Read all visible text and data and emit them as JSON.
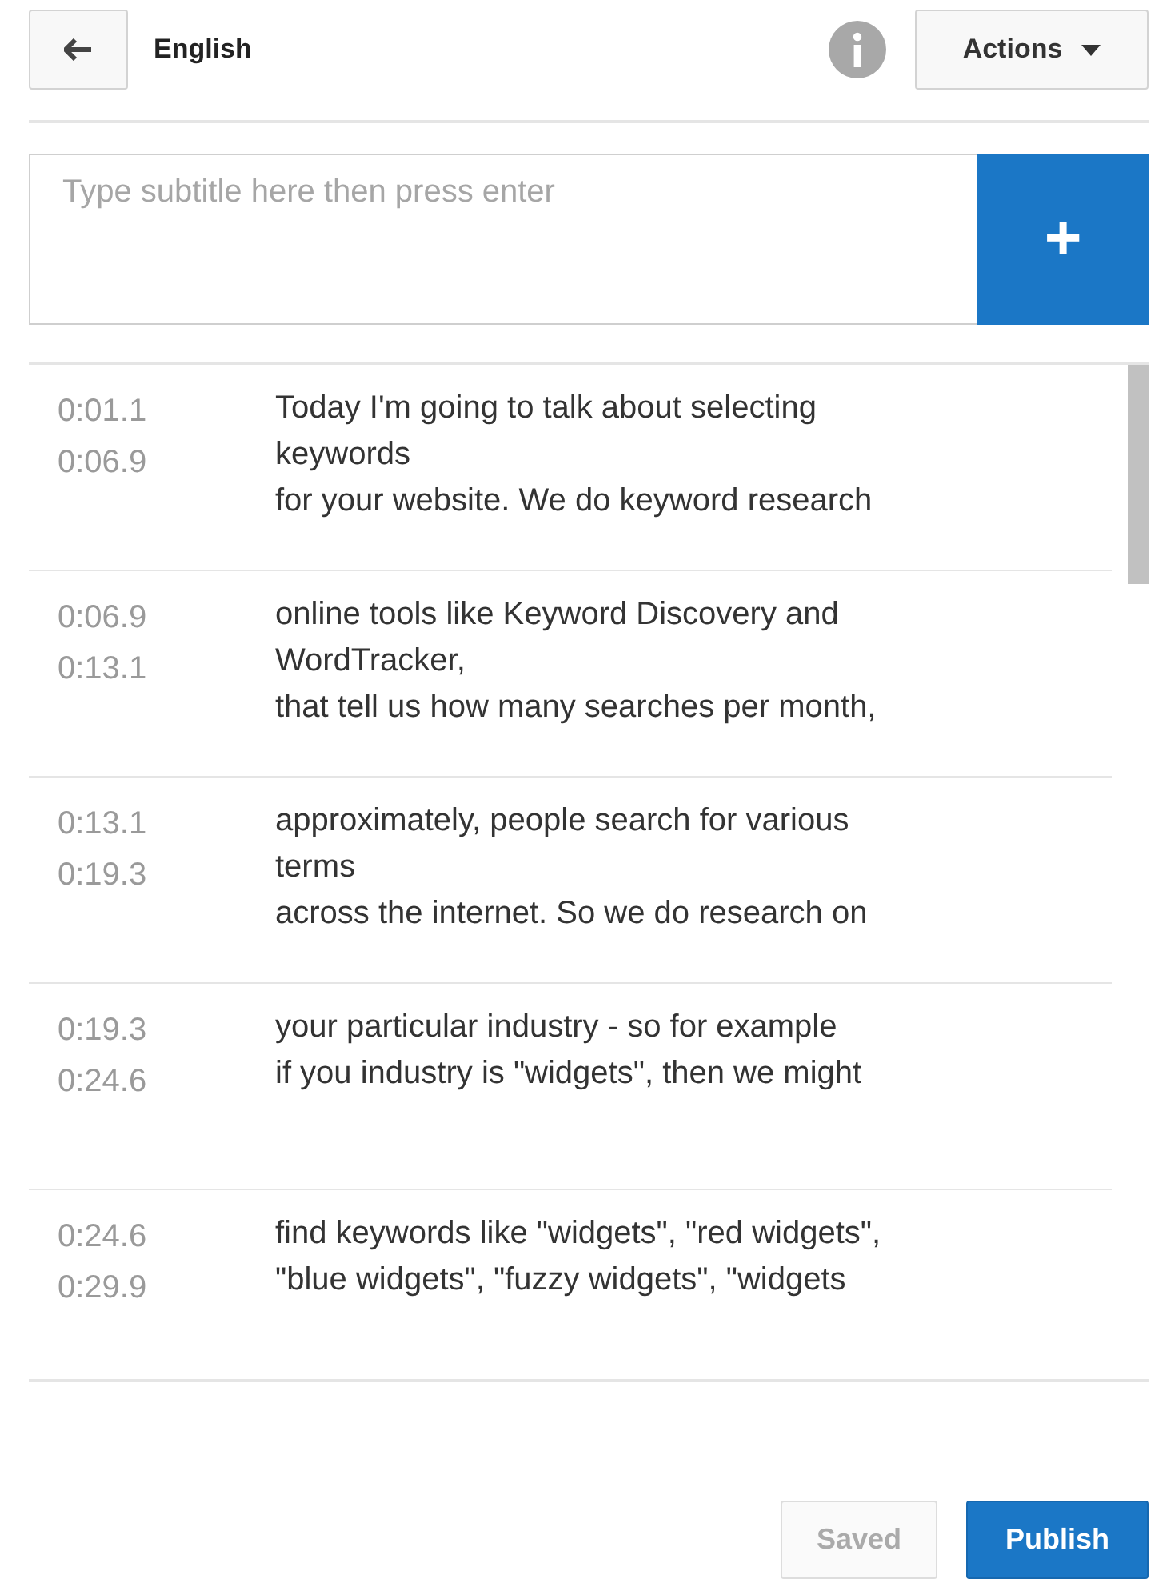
{
  "header": {
    "title": "English",
    "actions_label": "Actions"
  },
  "subtitle_input": {
    "placeholder": "Type subtitle here then press enter",
    "add_label": "+"
  },
  "cues": [
    {
      "start": "0:01.1",
      "end": "0:06.9",
      "lines": [
        "Today I'm going to talk about selecting",
        "keywords",
        "for your website. We do keyword research"
      ]
    },
    {
      "start": "0:06.9",
      "end": "0:13.1",
      "lines": [
        "online tools like Keyword Discovery and",
        "WordTracker,",
        "that tell us how many searches per month,"
      ]
    },
    {
      "start": "0:13.1",
      "end": "0:19.3",
      "lines": [
        "approximately, people search for various",
        "terms",
        "across the internet. So we do research on"
      ]
    },
    {
      "start": "0:19.3",
      "end": "0:24.6",
      "lines": [
        "your particular industry - so for example",
        "if you industry is \"widgets\", then we might"
      ]
    },
    {
      "start": "0:24.6",
      "end": "0:29.9",
      "lines": [
        "find keywords like \"widgets\", \"red widgets\",",
        "\"blue widgets\", \"fuzzy widgets\", \"widgets"
      ]
    }
  ],
  "footer": {
    "buttons": [
      {
        "label": "Saved",
        "kind": "secondary",
        "disabled": true
      },
      {
        "label": "Publish",
        "kind": "primary",
        "disabled": false
      }
    ]
  }
}
